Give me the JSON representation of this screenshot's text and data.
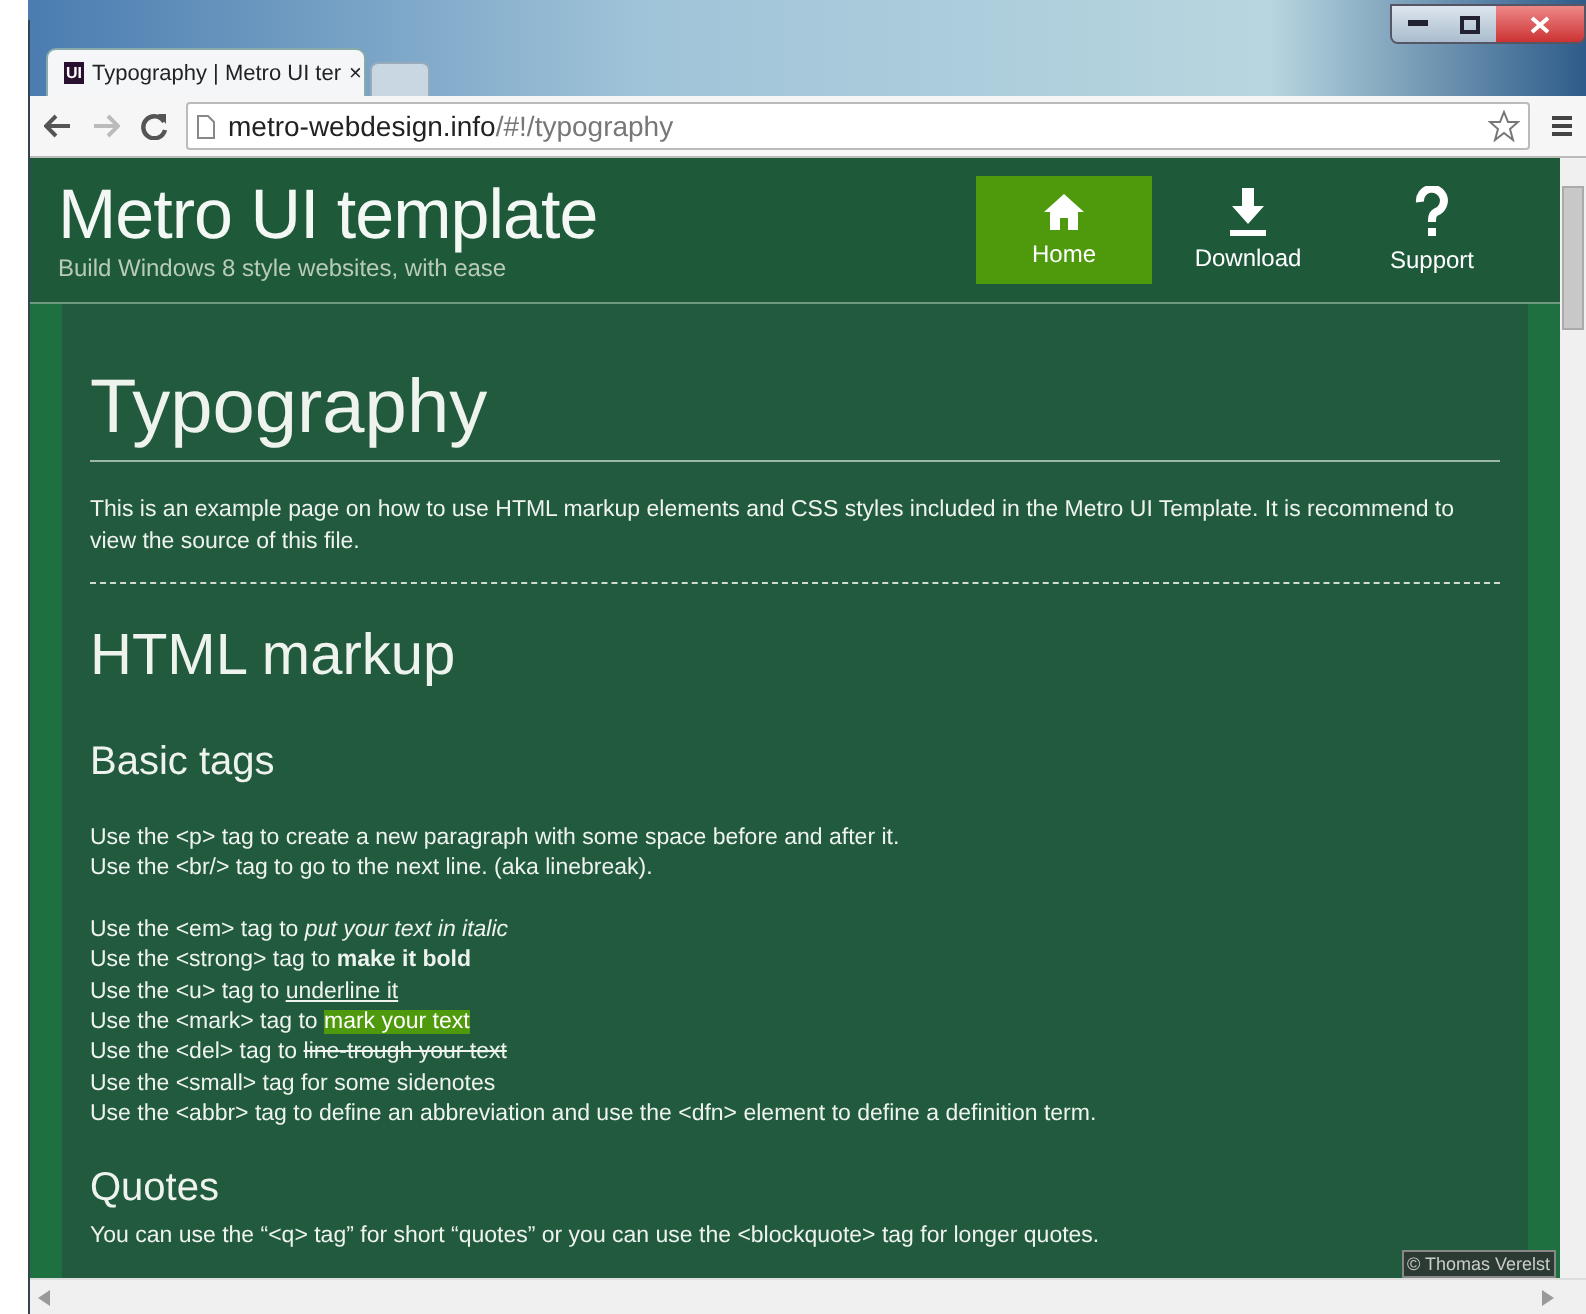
{
  "browser": {
    "tab": {
      "favicon": "UI",
      "title": "Typography | Metro UI ter",
      "close": "×",
      "selected": true
    },
    "url": {
      "host": "metro-webdesign.info",
      "path": "/#!/typography"
    }
  },
  "header": {
    "title": "Metro UI template",
    "subtitle": "Build Windows 8 style websites, with ease",
    "nav": [
      {
        "label": "Home",
        "kind": "home",
        "selected": true
      },
      {
        "label": "Download",
        "kind": "download",
        "selected": false
      },
      {
        "label": "Support",
        "kind": "help",
        "selected": false
      }
    ]
  },
  "content": {
    "title": "Typography",
    "intro": "This is an example page on how to use HTML markup elements and CSS styles included in the Metro UI Template. It is recommend to view the source of this file.",
    "section": "HTML markup",
    "subsection": "Basic tags",
    "paragraphs": [
      [
        {
          "text": "Use the <p> tag to create a new paragraph with some space before and after it."
        },
        {
          "text": "Use the <br/> tag to go to the next line. (aka linebreak)."
        }
      ],
      [
        {
          "text": "Use the <em> tag to ",
          "styled": {
            "kind": "italic",
            "text": "put your text in italic"
          }
        },
        {
          "text": "Use the <strong> tag to ",
          "styled": {
            "kind": "bold",
            "text": "make it bold"
          }
        },
        {
          "text": "Use the <u> tag to ",
          "styled": {
            "kind": "underline",
            "text": "underline it"
          }
        },
        {
          "text": "Use the <mark> tag to ",
          "styled": {
            "kind": "mark",
            "text": "mark your text"
          }
        },
        {
          "text": "Use the <del> tag to ",
          "styled": {
            "kind": "del",
            "text": "line-trough your text"
          }
        },
        {
          "text": "Use the <small> tag for some sidenotes"
        },
        {
          "text": "Use the <abbr> tag to define an abbreviation and use the <dfn> element to define a definition term."
        }
      ]
    ],
    "subsection_2": "Quotes",
    "quotes_text": "You can use the “<q> tag” for short “quotes” or you can use the <blockquote> tag for longer quotes."
  },
  "credit": "© Thomas Verelst"
}
